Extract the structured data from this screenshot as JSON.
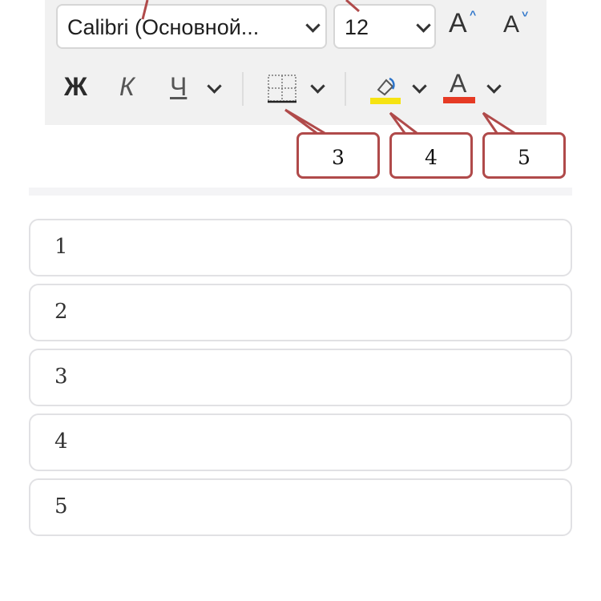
{
  "ribbon": {
    "font_name": "Calibri (Основной...",
    "font_size": "12",
    "grow_font_label": "A",
    "shrink_font_label": "A",
    "bold_label": "Ж",
    "italic_label": "К",
    "underline_label": "Ч",
    "font_color_label": "A",
    "highlight_color": "#f6e312",
    "font_color": "#e63a24"
  },
  "callouts": [
    {
      "label": "3"
    },
    {
      "label": "4"
    },
    {
      "label": "5"
    }
  ],
  "options": [
    {
      "label": "1"
    },
    {
      "label": "2"
    },
    {
      "label": "3"
    },
    {
      "label": "4"
    },
    {
      "label": "5"
    }
  ]
}
